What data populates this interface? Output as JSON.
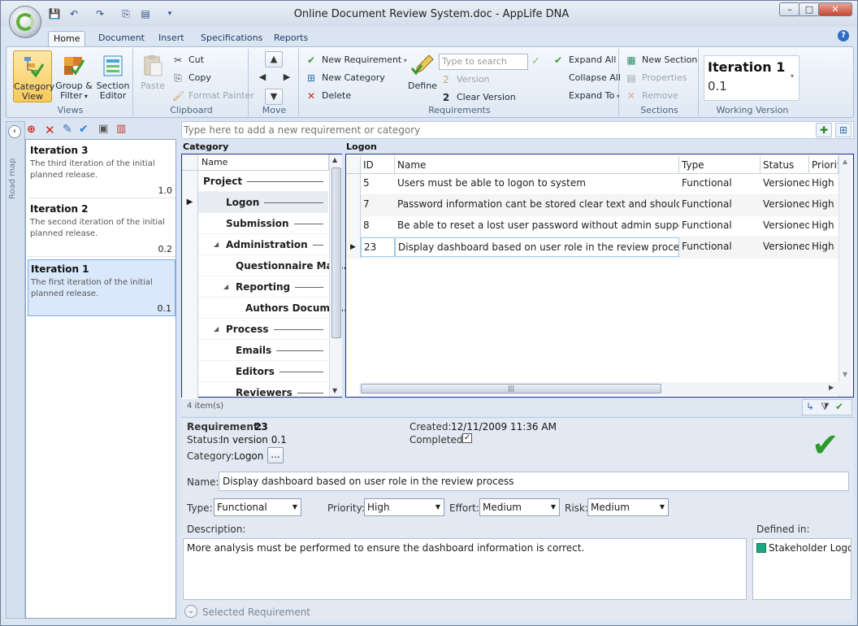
{
  "window": {
    "title": "Online Document Review System.doc - AppLife DNA"
  },
  "tabs": [
    "Home",
    "Document",
    "Insert",
    "Specifications",
    "Reports"
  ],
  "ribbon": {
    "views": {
      "label": "Views",
      "category_view": "Category View",
      "group_filter": "Group & Filter",
      "section_editor": "Section Editor"
    },
    "clipboard": {
      "label": "Clipboard",
      "paste": "Paste",
      "cut": "Cut",
      "copy": "Copy",
      "format_painter": "Format Painter"
    },
    "move": {
      "label": "Move"
    },
    "requirements": {
      "label": "Requirements",
      "new_requirement": "New Requirement",
      "new_category": "New Category",
      "delete": "Delete",
      "define": "Define",
      "search_placeholder": "Type to search",
      "version": "Version",
      "clear_version": "Clear Version",
      "expand_all": "Expand All",
      "collapse_all": "Collapse All",
      "expand_to": "Expand To"
    },
    "sections": {
      "label": "Sections",
      "new_section": "New Section",
      "properties": "Properties",
      "remove": "Remove"
    },
    "working_version": {
      "label": "Working Version",
      "title": "Iteration 1",
      "number": "0.1"
    }
  },
  "roadmap": {
    "vertical_label": "Road map",
    "items": [
      {
        "title": "Iteration 3",
        "desc": "The third iteration of the initial planned release.",
        "version": "1.0"
      },
      {
        "title": "Iteration 2",
        "desc": "The second iteration of the initial planned release.",
        "version": "0.2"
      },
      {
        "title": "Iteration 1",
        "desc": "The first iteration of the initial planned release.",
        "version": "0.1"
      }
    ]
  },
  "addbar": {
    "placeholder": "Type here to add a new requirement or category"
  },
  "category": {
    "header": "Category",
    "col_name": "Name",
    "rows": [
      {
        "name": "Project"
      },
      {
        "name": "Logon"
      },
      {
        "name": "Submission"
      },
      {
        "name": "Administration"
      },
      {
        "name": "Questionnaire Man..."
      },
      {
        "name": "Reporting"
      },
      {
        "name": "Authors Docume..."
      },
      {
        "name": "Process"
      },
      {
        "name": "Emails"
      },
      {
        "name": "Editors"
      },
      {
        "name": "Reviewers"
      }
    ]
  },
  "requirements": {
    "header": "Logon",
    "columns": [
      "ID",
      "Name",
      "Type",
      "Status",
      "Priorit"
    ],
    "rows": [
      {
        "id": "5",
        "name": "Users must be able to logon to system",
        "type": "Functional",
        "status": "Versioned",
        "priority": "High"
      },
      {
        "id": "7",
        "name": "Password information cant be stored clear text and shouldnt be...",
        "type": "Functional",
        "status": "Versioned",
        "priority": "High"
      },
      {
        "id": "8",
        "name": "Be able to reset a lost user password without admin support",
        "type": "Functional",
        "status": "Versioned",
        "priority": "High"
      },
      {
        "id": "23",
        "name": "Display dashboard based on user role in the review process",
        "type": "Functional",
        "status": "Versioned",
        "priority": "High"
      }
    ],
    "item_count": "4 item(s)"
  },
  "details": {
    "req_label": "Requirement:",
    "req_id": "23",
    "status_label": "Status:",
    "status_value": "In version 0.1",
    "category_label": "Category:",
    "category_value": "Logon",
    "browse": "...",
    "created_label": "Created:",
    "created_value": "12/11/2009 11:36 AM",
    "completed_label": "Completed:",
    "name_label": "Name:",
    "name_value": "Display dashboard based on user role in the review process",
    "type_label": "Type:",
    "type_value": "Functional",
    "priority_label": "Priority:",
    "priority_value": "High",
    "effort_label": "Effort:",
    "effort_value": "Medium",
    "risk_label": "Risk:",
    "risk_value": "Medium",
    "description_label": "Description:",
    "description_value": "More analysis must be performed to ensure the dashboard information is correct.",
    "defined_in_label": "Defined in:",
    "defined_in_value": "Stakeholder Logon",
    "footer": "Selected Requirement"
  }
}
